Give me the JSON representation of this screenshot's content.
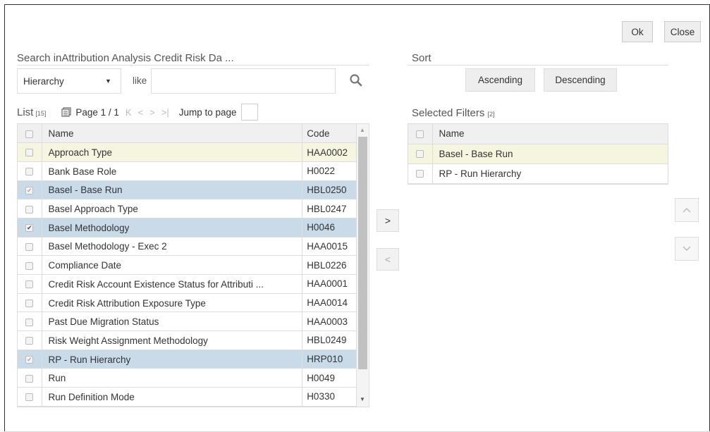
{
  "buttons": {
    "ok": "Ok",
    "close": "Close"
  },
  "search": {
    "title": "Search inAttribution Analysis Credit Risk Da ...",
    "field_select": "Hierarchy",
    "operator_label": "like",
    "input_value": ""
  },
  "sort": {
    "title": "Sort",
    "ascending": "Ascending",
    "descending": "Descending"
  },
  "list": {
    "label": "List",
    "count": "[15]",
    "page_text": "Page 1 / 1",
    "jump_label": "Jump to page",
    "columns": {
      "name": "Name",
      "code": "Code"
    },
    "rows": [
      {
        "name": "Approach Type",
        "code": "HAA0002",
        "state": "hover"
      },
      {
        "name": "Bank Base Role",
        "code": "H0022",
        "state": "none"
      },
      {
        "name": "Basel - Base Run",
        "code": "HBL0250",
        "state": "selected-grey"
      },
      {
        "name": "Basel Approach Type",
        "code": "HBL0247",
        "state": "none"
      },
      {
        "name": "Basel Methodology",
        "code": "H0046",
        "state": "selected"
      },
      {
        "name": "Basel Methodology - Exec 2",
        "code": "HAA0015",
        "state": "none"
      },
      {
        "name": "Compliance Date",
        "code": "HBL0226",
        "state": "none"
      },
      {
        "name": "Credit Risk Account Existence Status for Attributi ...",
        "code": "HAA0001",
        "state": "none"
      },
      {
        "name": "Credit Risk Attribution Exposure Type",
        "code": "HAA0014",
        "state": "none"
      },
      {
        "name": "Past Due Migration Status",
        "code": "HAA0003",
        "state": "none"
      },
      {
        "name": "Risk Weight Assignment Methodology",
        "code": "HBL0249",
        "state": "none"
      },
      {
        "name": "RP - Run Hierarchy",
        "code": "HRP010",
        "state": "selected-grey"
      },
      {
        "name": "Run",
        "code": "H0049",
        "state": "none"
      },
      {
        "name": "Run Definition Mode",
        "code": "H0330",
        "state": "none"
      },
      {
        "name": "",
        "code": "",
        "state": "none"
      }
    ]
  },
  "selected_filters": {
    "title": "Selected Filters",
    "count": "[2]",
    "column": "Name",
    "rows": [
      {
        "name": "Basel - Base Run",
        "state": "hover"
      },
      {
        "name": "RP - Run Hierarchy",
        "state": "none"
      }
    ]
  }
}
